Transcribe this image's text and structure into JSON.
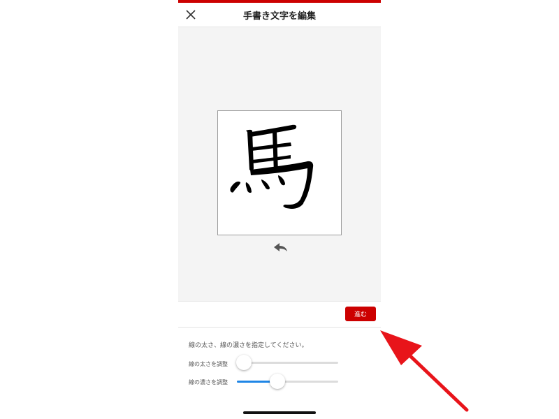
{
  "header": {
    "title": "手書き文字を編集",
    "close_icon": "close-icon"
  },
  "canvas": {
    "character": "馬",
    "undo_icon": "undo-icon"
  },
  "actions": {
    "next_label": "進む"
  },
  "settings": {
    "instruction": "線の太さ、線の濃さを指定してください。",
    "sliders": [
      {
        "label": "線の太さを調整",
        "value": 0.07
      },
      {
        "label": "線の濃さを調整",
        "value": 0.4
      }
    ]
  },
  "colors": {
    "accent_red": "#cc0000",
    "slider_blue": "#1f86e6",
    "annotation_red": "#e8141a"
  }
}
